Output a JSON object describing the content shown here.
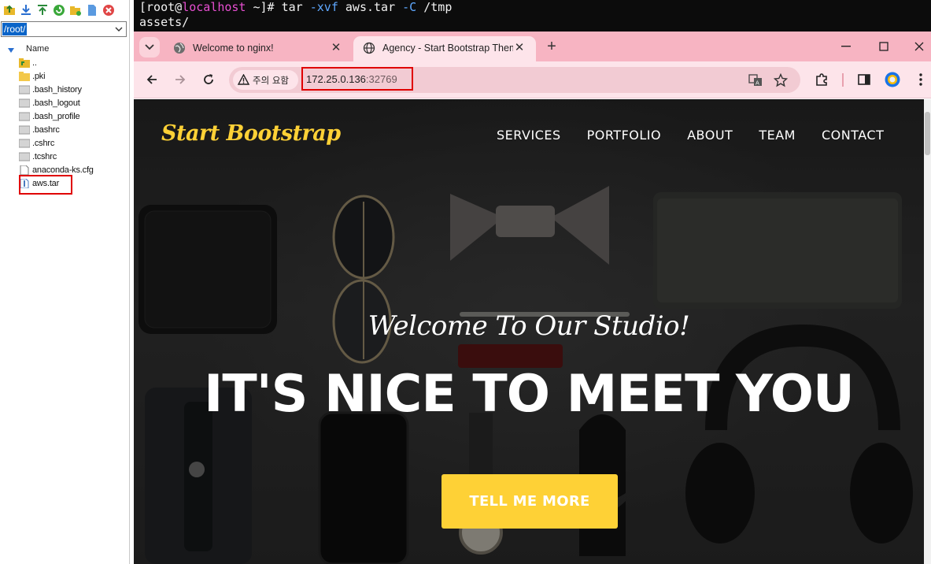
{
  "file_manager": {
    "path": "/root/",
    "column_header": "Name",
    "files": [
      {
        "name": "..",
        "icon": "parent-folder-icon"
      },
      {
        "name": ".pki",
        "icon": "folder-icon"
      },
      {
        "name": ".bash_history",
        "icon": "file-icon"
      },
      {
        "name": ".bash_logout",
        "icon": "file-icon"
      },
      {
        "name": ".bash_profile",
        "icon": "file-icon"
      },
      {
        "name": ".bashrc",
        "icon": "file-icon"
      },
      {
        "name": ".cshrc",
        "icon": "file-icon"
      },
      {
        "name": ".tcshrc",
        "icon": "file-icon"
      },
      {
        "name": "anaconda-ks.cfg",
        "icon": "document-icon"
      },
      {
        "name": "aws.tar",
        "icon": "archive-icon"
      }
    ]
  },
  "terminal": {
    "prompt_user": "[root@",
    "prompt_host": "localhost",
    "prompt_tail": " ~]# ",
    "cmd_part1": "tar ",
    "cmd_flag1": "-xvf",
    "cmd_part2": " aws.tar ",
    "cmd_flag2": "-C",
    "cmd_part3": " /tmp",
    "output_line": "assets/"
  },
  "browser": {
    "tabs": [
      {
        "title": "Welcome to nginx!",
        "close": "✕"
      },
      {
        "title": "Agency - Start Bootstrap Theme",
        "close": "✕"
      }
    ],
    "new_tab": "+",
    "security_label": "주의 요함",
    "url_host": "172.25.0.136",
    "url_port": ":32769"
  },
  "page": {
    "brand": "Start Bootstrap",
    "nav": [
      "SERVICES",
      "PORTFOLIO",
      "ABOUT",
      "TEAM",
      "CONTACT"
    ],
    "subheading": "Welcome To Our Studio!",
    "heading": "IT'S NICE TO MEET YOU",
    "cta": "TELL ME MORE"
  },
  "colors": {
    "accent": "#fed136",
    "tab_strip": "#f7b4c2",
    "toolbar": "#fde4ea",
    "highlight": "#e00000"
  }
}
